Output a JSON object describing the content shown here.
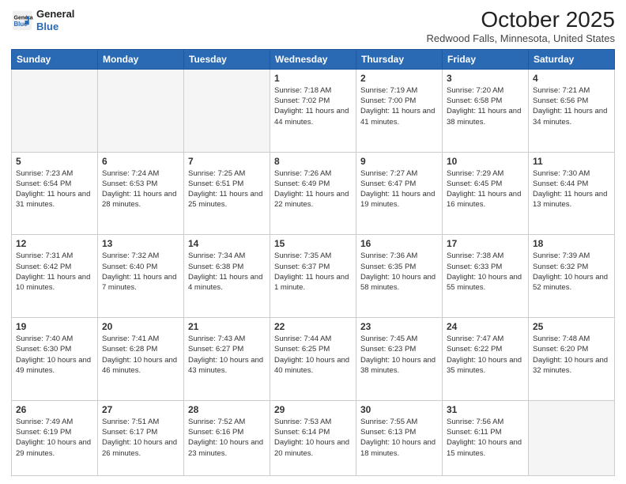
{
  "header": {
    "logo_line1": "General",
    "logo_line2": "Blue",
    "title": "October 2025",
    "subtitle": "Redwood Falls, Minnesota, United States"
  },
  "days_of_week": [
    "Sunday",
    "Monday",
    "Tuesday",
    "Wednesday",
    "Thursday",
    "Friday",
    "Saturday"
  ],
  "weeks": [
    [
      {
        "day": "",
        "info": ""
      },
      {
        "day": "",
        "info": ""
      },
      {
        "day": "",
        "info": ""
      },
      {
        "day": "1",
        "info": "Sunrise: 7:18 AM\nSunset: 7:02 PM\nDaylight: 11 hours and 44 minutes."
      },
      {
        "day": "2",
        "info": "Sunrise: 7:19 AM\nSunset: 7:00 PM\nDaylight: 11 hours and 41 minutes."
      },
      {
        "day": "3",
        "info": "Sunrise: 7:20 AM\nSunset: 6:58 PM\nDaylight: 11 hours and 38 minutes."
      },
      {
        "day": "4",
        "info": "Sunrise: 7:21 AM\nSunset: 6:56 PM\nDaylight: 11 hours and 34 minutes."
      }
    ],
    [
      {
        "day": "5",
        "info": "Sunrise: 7:23 AM\nSunset: 6:54 PM\nDaylight: 11 hours and 31 minutes."
      },
      {
        "day": "6",
        "info": "Sunrise: 7:24 AM\nSunset: 6:53 PM\nDaylight: 11 hours and 28 minutes."
      },
      {
        "day": "7",
        "info": "Sunrise: 7:25 AM\nSunset: 6:51 PM\nDaylight: 11 hours and 25 minutes."
      },
      {
        "day": "8",
        "info": "Sunrise: 7:26 AM\nSunset: 6:49 PM\nDaylight: 11 hours and 22 minutes."
      },
      {
        "day": "9",
        "info": "Sunrise: 7:27 AM\nSunset: 6:47 PM\nDaylight: 11 hours and 19 minutes."
      },
      {
        "day": "10",
        "info": "Sunrise: 7:29 AM\nSunset: 6:45 PM\nDaylight: 11 hours and 16 minutes."
      },
      {
        "day": "11",
        "info": "Sunrise: 7:30 AM\nSunset: 6:44 PM\nDaylight: 11 hours and 13 minutes."
      }
    ],
    [
      {
        "day": "12",
        "info": "Sunrise: 7:31 AM\nSunset: 6:42 PM\nDaylight: 11 hours and 10 minutes."
      },
      {
        "day": "13",
        "info": "Sunrise: 7:32 AM\nSunset: 6:40 PM\nDaylight: 11 hours and 7 minutes."
      },
      {
        "day": "14",
        "info": "Sunrise: 7:34 AM\nSunset: 6:38 PM\nDaylight: 11 hours and 4 minutes."
      },
      {
        "day": "15",
        "info": "Sunrise: 7:35 AM\nSunset: 6:37 PM\nDaylight: 11 hours and 1 minute."
      },
      {
        "day": "16",
        "info": "Sunrise: 7:36 AM\nSunset: 6:35 PM\nDaylight: 10 hours and 58 minutes."
      },
      {
        "day": "17",
        "info": "Sunrise: 7:38 AM\nSunset: 6:33 PM\nDaylight: 10 hours and 55 minutes."
      },
      {
        "day": "18",
        "info": "Sunrise: 7:39 AM\nSunset: 6:32 PM\nDaylight: 10 hours and 52 minutes."
      }
    ],
    [
      {
        "day": "19",
        "info": "Sunrise: 7:40 AM\nSunset: 6:30 PM\nDaylight: 10 hours and 49 minutes."
      },
      {
        "day": "20",
        "info": "Sunrise: 7:41 AM\nSunset: 6:28 PM\nDaylight: 10 hours and 46 minutes."
      },
      {
        "day": "21",
        "info": "Sunrise: 7:43 AM\nSunset: 6:27 PM\nDaylight: 10 hours and 43 minutes."
      },
      {
        "day": "22",
        "info": "Sunrise: 7:44 AM\nSunset: 6:25 PM\nDaylight: 10 hours and 40 minutes."
      },
      {
        "day": "23",
        "info": "Sunrise: 7:45 AM\nSunset: 6:23 PM\nDaylight: 10 hours and 38 minutes."
      },
      {
        "day": "24",
        "info": "Sunrise: 7:47 AM\nSunset: 6:22 PM\nDaylight: 10 hours and 35 minutes."
      },
      {
        "day": "25",
        "info": "Sunrise: 7:48 AM\nSunset: 6:20 PM\nDaylight: 10 hours and 32 minutes."
      }
    ],
    [
      {
        "day": "26",
        "info": "Sunrise: 7:49 AM\nSunset: 6:19 PM\nDaylight: 10 hours and 29 minutes."
      },
      {
        "day": "27",
        "info": "Sunrise: 7:51 AM\nSunset: 6:17 PM\nDaylight: 10 hours and 26 minutes."
      },
      {
        "day": "28",
        "info": "Sunrise: 7:52 AM\nSunset: 6:16 PM\nDaylight: 10 hours and 23 minutes."
      },
      {
        "day": "29",
        "info": "Sunrise: 7:53 AM\nSunset: 6:14 PM\nDaylight: 10 hours and 20 minutes."
      },
      {
        "day": "30",
        "info": "Sunrise: 7:55 AM\nSunset: 6:13 PM\nDaylight: 10 hours and 18 minutes."
      },
      {
        "day": "31",
        "info": "Sunrise: 7:56 AM\nSunset: 6:11 PM\nDaylight: 10 hours and 15 minutes."
      },
      {
        "day": "",
        "info": ""
      }
    ]
  ]
}
